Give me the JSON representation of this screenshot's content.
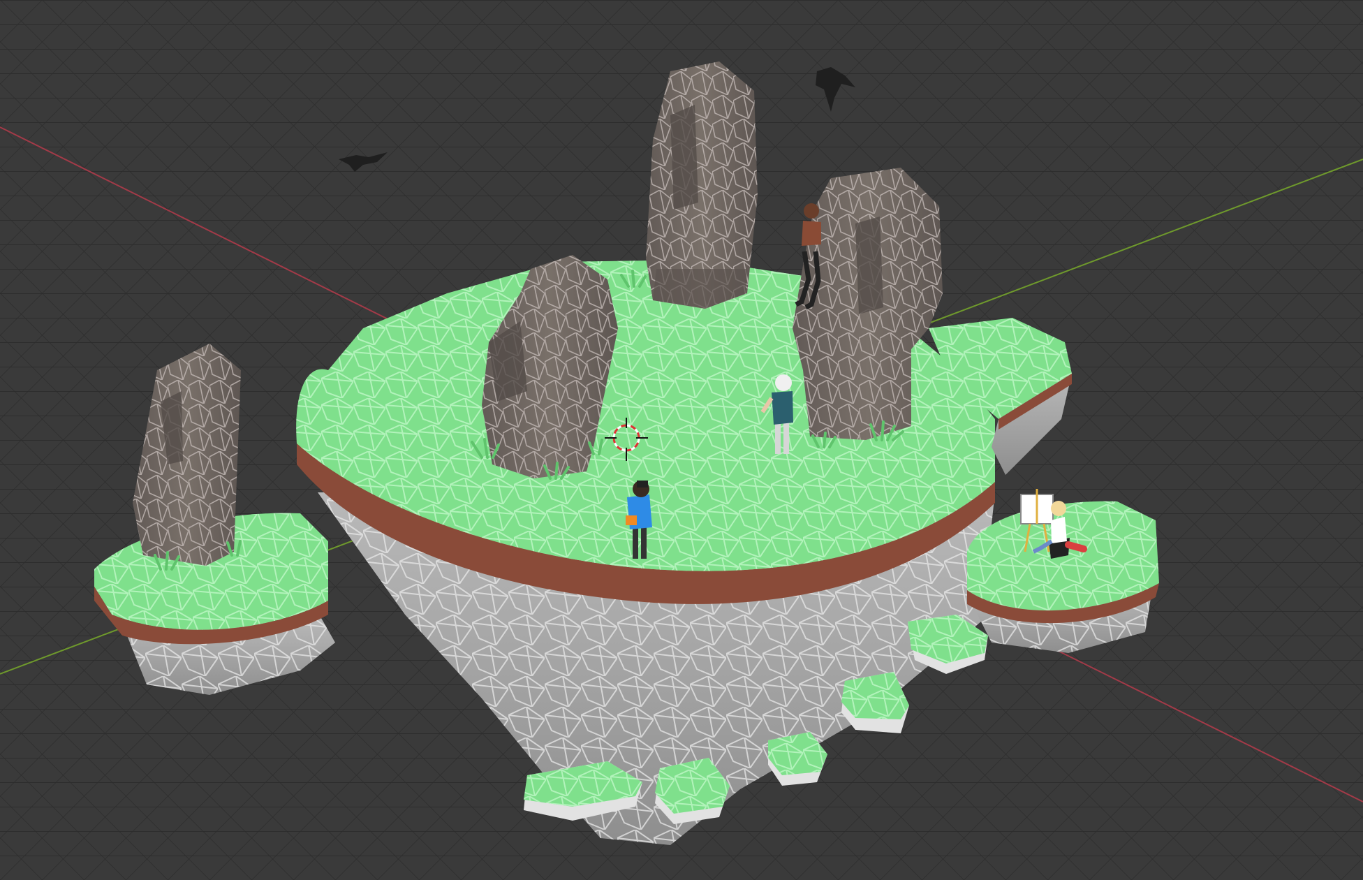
{
  "app": "3D viewport",
  "colors": {
    "background": "#3a3a3a",
    "grid_line": "#2c2c2c",
    "x_axis": "#a33a48",
    "y_axis": "#6f9a2c",
    "grass": "#7fe08c",
    "grass_wire": "#b8f5c0",
    "dirt": "#8a4b39",
    "rock_underside": "#a9a9a9",
    "moai": "#6e6662",
    "moai_wire": "#bdb4b0"
  },
  "objects": [
    "main-floating-island",
    "left-small-island",
    "right-small-island",
    "stepping-stones",
    "moai-statue-left",
    "moai-statue-front",
    "moai-statue-back",
    "moai-statue-right",
    "character-photographer",
    "character-standing",
    "character-sitting-on-moai",
    "character-painter",
    "bird-left",
    "bird-right",
    "3d-cursor"
  ]
}
